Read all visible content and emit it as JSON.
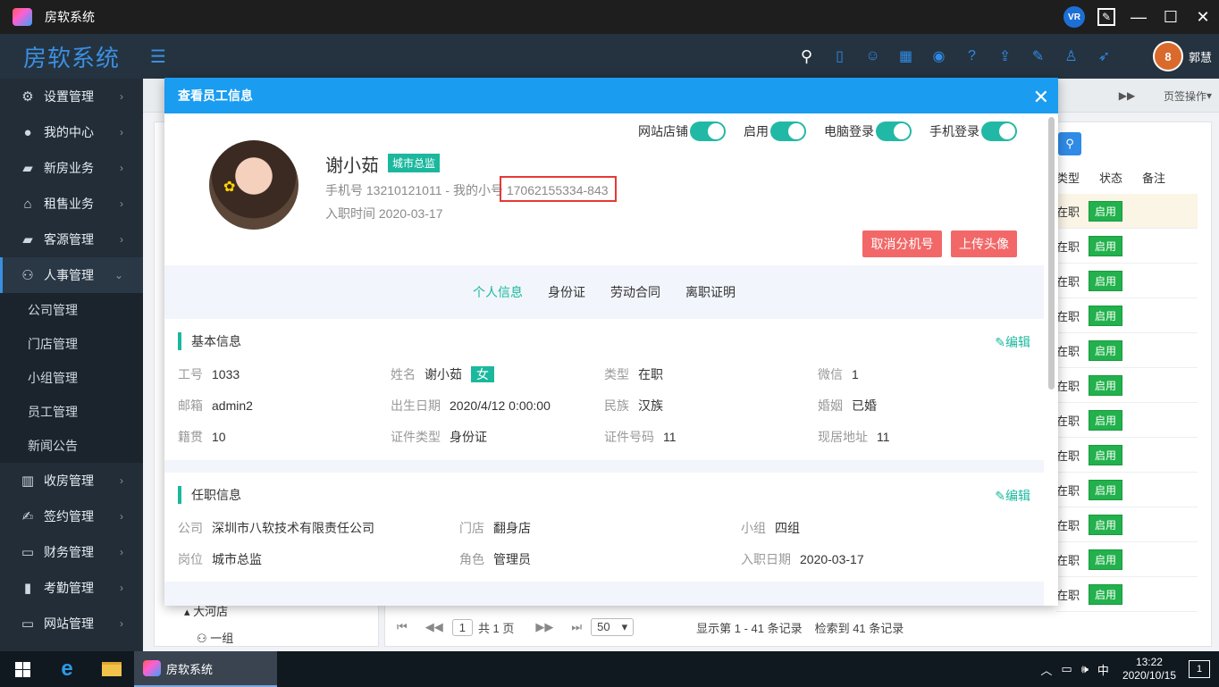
{
  "window": {
    "title": "房软系统"
  },
  "header": {
    "brand": "房软系统",
    "user_name": "郭慧",
    "user_badge": "8"
  },
  "sidebar": {
    "items": [
      {
        "label": "设置管理",
        "icon": "gear-icon"
      },
      {
        "label": "我的中心",
        "icon": "user-icon"
      },
      {
        "label": "新房业务",
        "icon": "car-icon"
      },
      {
        "label": "租售业务",
        "icon": "house-icon"
      },
      {
        "label": "客源管理",
        "icon": "car-icon"
      },
      {
        "label": "人事管理",
        "icon": "org-icon"
      }
    ],
    "subitems": [
      "公司管理",
      "门店管理",
      "小组管理",
      "员工管理",
      "新闻公告"
    ],
    "items_after": [
      {
        "label": "收房管理",
        "icon": "building-icon"
      },
      {
        "label": "签约管理",
        "icon": "sign-icon"
      },
      {
        "label": "财务管理",
        "icon": "card-icon"
      },
      {
        "label": "考勤管理",
        "icon": "chart-icon"
      },
      {
        "label": "网站管理",
        "icon": "monitor-icon"
      }
    ]
  },
  "tabbar": {
    "page_ops": "页签操作"
  },
  "grid": {
    "headers": [
      "类型",
      "状态",
      "备注"
    ],
    "rows": [
      {
        "type": "在职",
        "status": "启用"
      },
      {
        "type": "在职",
        "status": "启用"
      },
      {
        "type": "在职",
        "status": "启用"
      },
      {
        "type": "在职",
        "status": "启用"
      },
      {
        "type": "在职",
        "status": "启用"
      },
      {
        "type": "在职",
        "status": "启用"
      },
      {
        "type": "在职",
        "status": "启用"
      },
      {
        "type": "在职",
        "status": "启用"
      },
      {
        "type": "在职",
        "status": "启用"
      },
      {
        "type": "在职",
        "status": "启用"
      },
      {
        "type": "在职",
        "status": "启用"
      },
      {
        "type": "在职",
        "status": "启用"
      }
    ]
  },
  "tree": {
    "store": "大河店",
    "group": "一组"
  },
  "pager": {
    "page": "1",
    "total_pages_text": "共 1 页",
    "page_size": "50",
    "summary": "显示第 1 - 41 条记录",
    "found": "检索到 41 条记录"
  },
  "modal": {
    "title": "查看员工信息",
    "toggles": [
      {
        "label": "网站店铺",
        "on": true
      },
      {
        "label": "启用",
        "on": true
      },
      {
        "label": "电脑登录",
        "on": true
      },
      {
        "label": "手机登录",
        "on": true
      }
    ],
    "name": "谢小茹",
    "role": "城市总监",
    "phone_label": "手机号",
    "phone": "13210121011",
    "sep": " - ",
    "ext_label": "我的小号",
    "ext": "17062155334-843",
    "entry_label": "入职时间",
    "entry_date": "2020-03-17",
    "btn_cancel_ext": "取消分机号",
    "btn_upload_avatar": "上传头像",
    "tabs": [
      "个人信息",
      "身份证",
      "劳动合同",
      "离职证明"
    ],
    "basic": {
      "title": "基本信息",
      "edit": "编辑",
      "fields": [
        {
          "label": "工号",
          "value": "1033"
        },
        {
          "label": "姓名",
          "value": "谢小茹",
          "badge": "女"
        },
        {
          "label": "类型",
          "value": "在职"
        },
        {
          "label": "微信",
          "value": "1"
        },
        {
          "label": "邮箱",
          "value": "admin2"
        },
        {
          "label": "出生日期",
          "value": "2020/4/12 0:00:00"
        },
        {
          "label": "民族",
          "value": "汉族"
        },
        {
          "label": "婚姻",
          "value": "已婚"
        },
        {
          "label": "籍贯",
          "value": "10"
        },
        {
          "label": "证件类型",
          "value": "身份证"
        },
        {
          "label": "证件号码",
          "value": "11"
        },
        {
          "label": "现居地址",
          "value": "11"
        }
      ]
    },
    "job": {
      "title": "任职信息",
      "edit": "编辑",
      "fields": [
        {
          "label": "公司",
          "value": "深圳市八软技术有限责任公司"
        },
        {
          "label": "门店",
          "value": "翻身店"
        },
        {
          "label": "小组",
          "value": "四组"
        },
        {
          "label": "岗位",
          "value": "城市总监"
        },
        {
          "label": "角色",
          "value": "管理员"
        },
        {
          "label": "入职日期",
          "value": "2020-03-17"
        }
      ]
    }
  },
  "taskbar": {
    "app_label": "房软系统",
    "ime": "中",
    "time": "13:22",
    "date": "2020/10/15",
    "notifications": "1"
  },
  "colors": {
    "accent": "#1bb89e",
    "header_blue": "#1a9cf0",
    "danger": "#f26868",
    "highlight": "#e53935"
  }
}
